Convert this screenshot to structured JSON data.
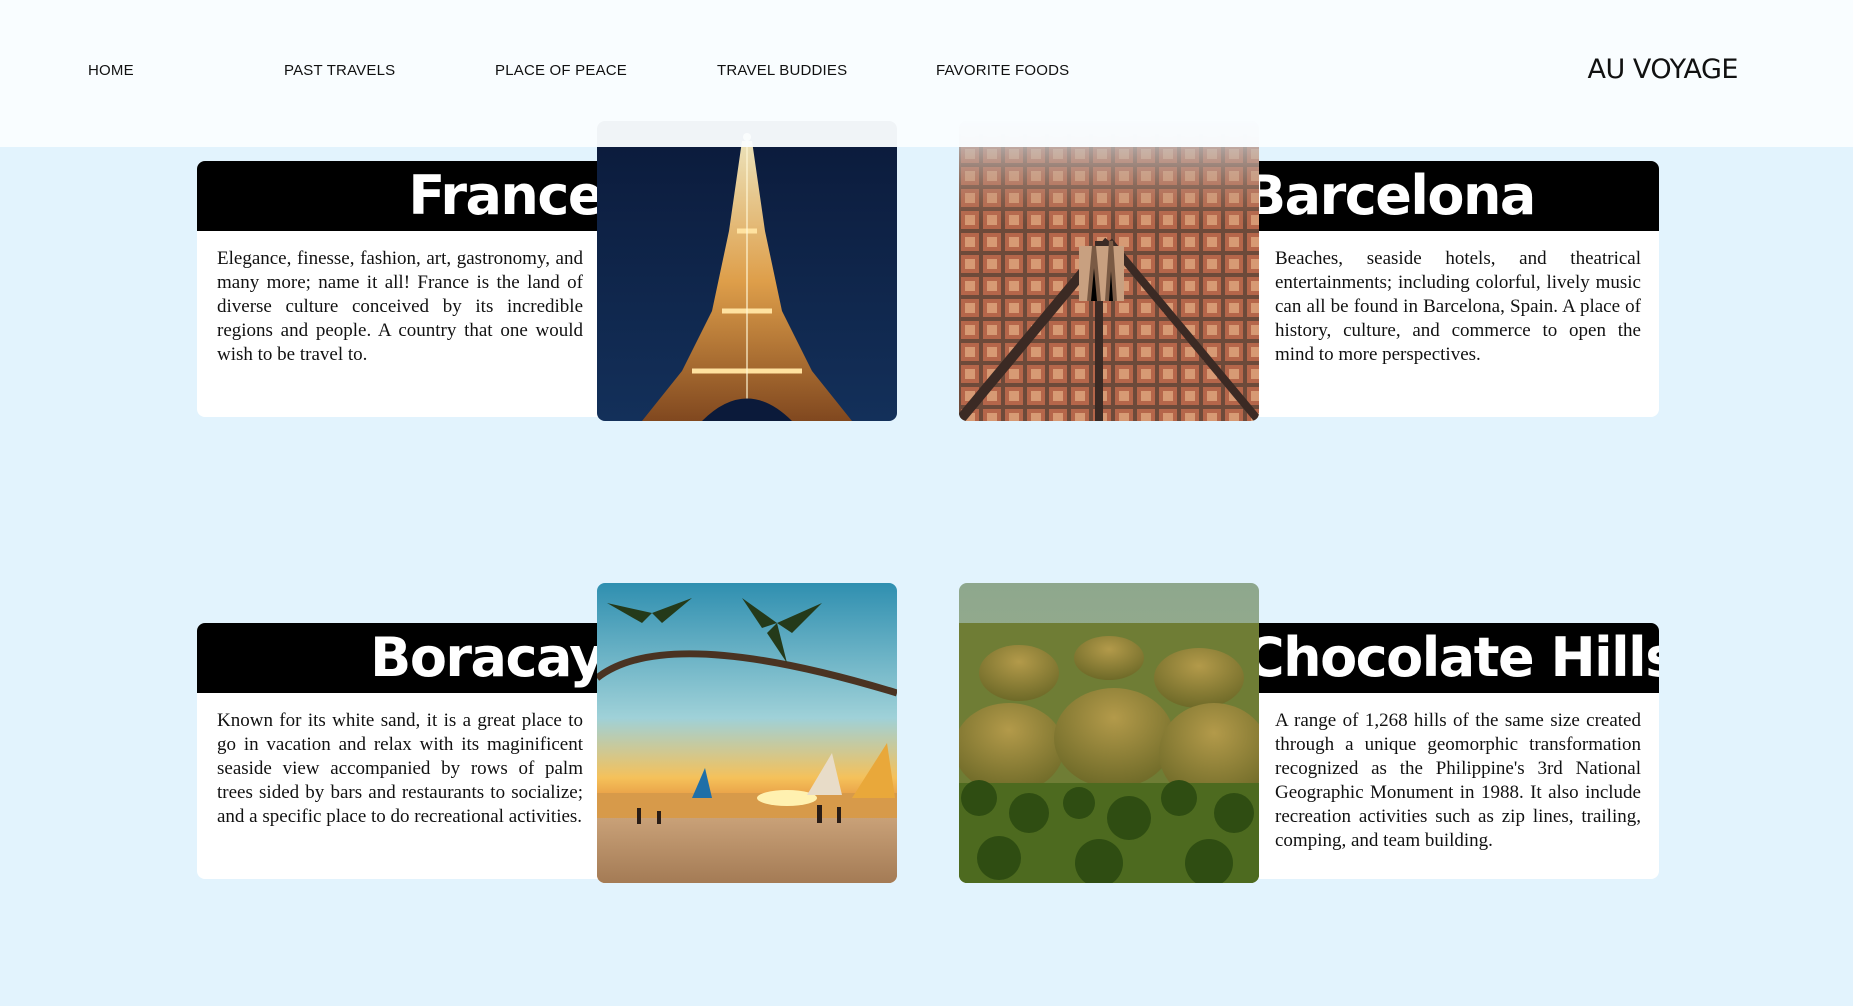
{
  "nav": {
    "links": [
      "HOME",
      "PAST TRAVELS",
      "PLACE OF PEACE",
      "TRAVEL BUDDIES",
      "FAVORITE FOODS"
    ],
    "brand": "AU VOYAGE"
  },
  "cards": [
    {
      "title": "France",
      "description": "Elegance, finesse, fashion, art, gastronomy, and many more; name it all! France is the land of diverse culture conceived by its incredible regions and people. A country that one would wish to be travel to.",
      "image": "eiffel-tower-photo"
    },
    {
      "title": "Barcelona",
      "description": "Beaches, seaside hotels, and theatrical entertainments; including colorful, lively music can all be found in Barcelona, Spain. A place of history, culture, and commerce to open the mind to more perspectives.",
      "image": "barcelona-aerial-photo"
    },
    {
      "title": "Boracay",
      "description": "Known for its white sand, it is a great place to go in vacation and relax with its maginificent seaside view accompanied by rows of palm trees sided by bars and restaurants to socialize; and a specific place to do recreational activities.",
      "image": "boracay-beach-photo"
    },
    {
      "title": "Chocolate Hills",
      "description": "A range of 1,268 hills of the same size created through a unique geomorphic transformation recognized as the Philippine's 3rd National Geographic Monument in 1988. It also include recreation activities such as zip lines, trailing, comping, and team building.",
      "image": "chocolate-hills-photo"
    }
  ],
  "colors": {
    "page_background": "#e2f3fd",
    "header_background": "#fafdff",
    "title_bar": "#000000",
    "card_background": "#ffffff"
  }
}
